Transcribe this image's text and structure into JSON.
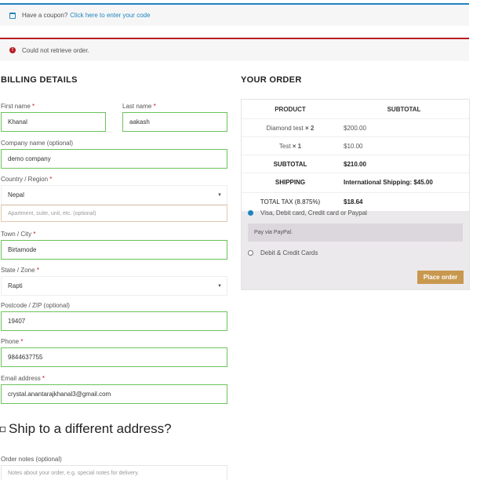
{
  "notices": {
    "coupon_text": "Have a coupon?",
    "coupon_link": "Click here to enter your code",
    "error_text": "Could not retrieve order."
  },
  "billing": {
    "heading": "BILLING DETAILS",
    "first_name_label": "First name",
    "first_name_value": "Khanal",
    "last_name_label": "Last name",
    "last_name_value": "aakash",
    "company_label": "Company name (optional)",
    "company_value": "demo company",
    "country_label": "Country / Region",
    "country_value": "Nepal",
    "apartment_placeholder": "Apartment, suite, unit, etc. (optional)",
    "town_label": "Town / City",
    "town_value": "Birtamode",
    "state_label": "State / Zone",
    "state_value": "Rapti",
    "postcode_label": "Postcode / ZIP (optional)",
    "postcode_value": "19407",
    "phone_label": "Phone",
    "phone_value": "9844637755",
    "email_label": "Email address",
    "email_value": "crystal.anantarajkhanal3@gmail.com",
    "required_mark": "*"
  },
  "shipping": {
    "ship_label": "Ship to a different address?",
    "notes_label": "Order notes (optional)",
    "notes_placeholder": "Notes about your order, e.g. special notes for delivery."
  },
  "order": {
    "heading": "YOUR ORDER",
    "col_product": "PRODUCT",
    "col_subtotal": "SUBTOTAL",
    "items": [
      {
        "name": "Diamond test",
        "qty": "× 2",
        "price": "$200.00"
      },
      {
        "name": "Test",
        "qty": "× 1",
        "price": "$10.00"
      }
    ],
    "subtotal_label": "SUBTOTAL",
    "subtotal_value": "$210.00",
    "shipping_label": "SHIPPING",
    "shipping_value": "International Shipping: $45.00",
    "tax_label": "TOTAL TAX (8.875%)",
    "tax_value": "$18.64"
  },
  "payment": {
    "option1": "Visa, Debit card, Credit card or Paypal",
    "option1_desc": "Pay via PayPal.",
    "option2": "Debit & Credit Cards",
    "place_order": "Place order"
  },
  "colors": {
    "accent": "#c8984f",
    "info": "#1e85be",
    "error": "#b81c23",
    "valid_border": "#6dc35c"
  }
}
